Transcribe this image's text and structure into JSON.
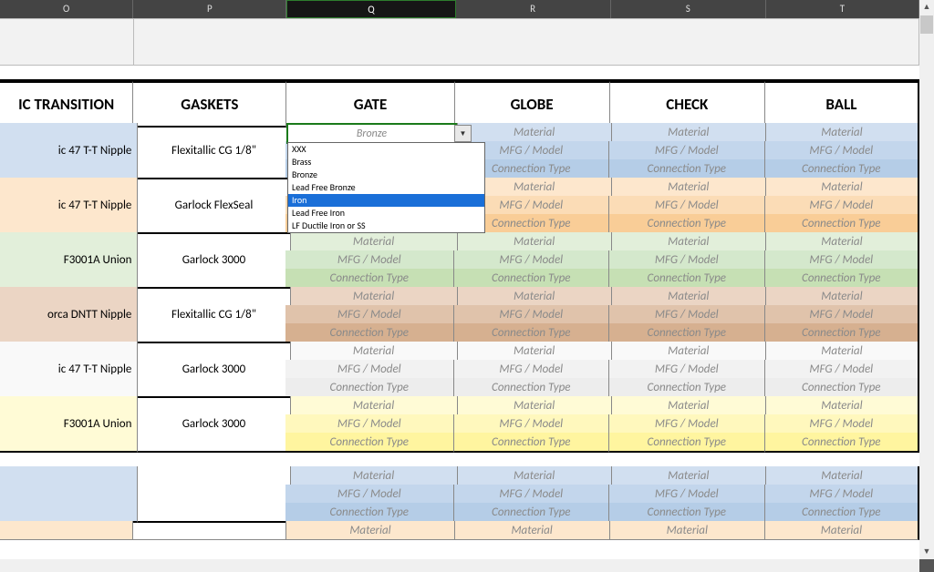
{
  "columns": {
    "O": "O",
    "P": "P",
    "Q": "Q",
    "R": "R",
    "S": "S",
    "T": "T"
  },
  "headers": {
    "o": "IC TRANSITION",
    "p": "GASKETS",
    "q": "GATE",
    "r": "GLOBE",
    "s": "CHECK",
    "t": "BALL"
  },
  "dd": {
    "value": "Bronze",
    "opts": [
      "XXX",
      "Brass",
      "Bronze",
      "Lead Free Bronze",
      "Iron",
      "Lead Free Iron",
      "LF Ductile Iron or SS"
    ]
  },
  "labels": {
    "mat": "Material",
    "mfg": "MFG / Model",
    "conn": "Connection Type"
  },
  "rows": [
    {
      "o": "ic 47 T-T Nipple",
      "p": "Flexitallic CG 1/8\"",
      "cls": "blue",
      "first": true
    },
    {
      "o": "ic 47 T-T Nipple",
      "p": "Garlock FlexSeal",
      "cls": "org"
    },
    {
      "o": "F3001A Union",
      "p": "Garlock 3000",
      "cls": "grn"
    },
    {
      "o": "orca DNTT Nipple",
      "p": "Flexitallic CG 1/8\"",
      "cls": "tan"
    },
    {
      "o": "ic 47 T-T Nipple",
      "p": "Garlock 3000",
      "cls": "wht"
    },
    {
      "o": "F3001A Union",
      "p": "Garlock 3000",
      "cls": "yel"
    },
    {
      "o": "",
      "p": "",
      "cls": "blue",
      "gap": true
    },
    {
      "o": "",
      "p": "",
      "cls": "org",
      "partial": true
    }
  ]
}
